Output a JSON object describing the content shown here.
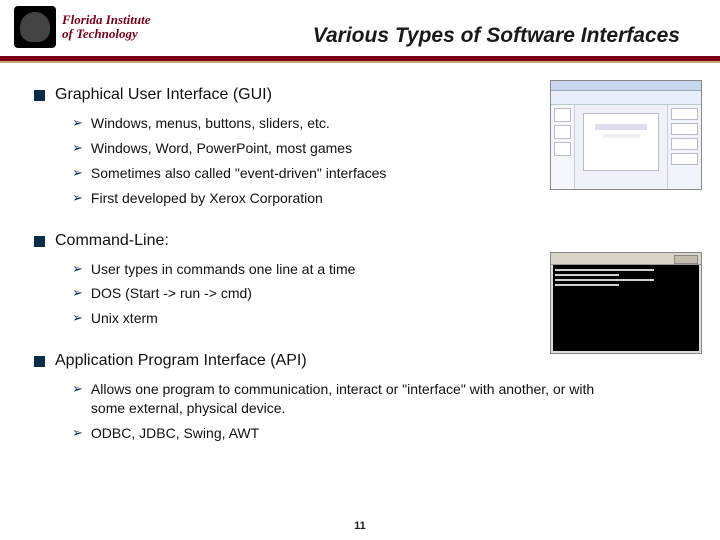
{
  "logo": {
    "line1": "Florida Institute",
    "line2": "of Technology"
  },
  "title": "Various Types of Software Interfaces",
  "sections": [
    {
      "heading": "Graphical User Interface (GUI)",
      "items": [
        "Windows, menus, buttons, sliders, etc.",
        "Windows, Word, PowerPoint, most games",
        "Sometimes also called \"event-driven\" interfaces",
        "First developed by Xerox Corporation"
      ]
    },
    {
      "heading": "Command-Line:",
      "items": [
        "User types in commands one line at a time",
        "DOS (Start -> run -> cmd)",
        "Unix xterm"
      ]
    },
    {
      "heading": "Application Program Interface (API)",
      "items": [
        "Allows one program to communication, interact or \"interface\" with another, or with some external, physical device.",
        "ODBC, JDBC, Swing, AWT"
      ]
    }
  ],
  "page_number": "11"
}
